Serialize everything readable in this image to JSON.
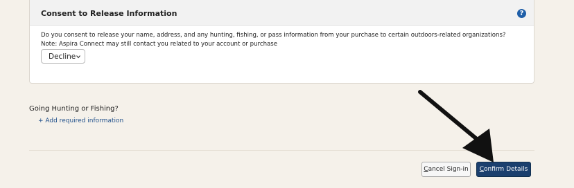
{
  "consent_panel": {
    "title": "Consent to Release Information",
    "help_icon_glyph": "?",
    "question": "Do you consent to release your name, address, and any hunting, fishing, or pass information from your purchase to certain outdoors-related organizations?",
    "note": "Note: Aspira Connect may still contact you related to your account or purchase",
    "select": {
      "selected": "Decline"
    }
  },
  "hunting_section": {
    "label": "Going Hunting or Fishing?",
    "add_link": "+ Add required information"
  },
  "footer": {
    "cancel_first_letter": "C",
    "cancel_rest": "ancel Sign-in",
    "confirm_first_letter": "C",
    "confirm_rest": "onfirm Details"
  },
  "colors": {
    "confirm_button": "#1b3f6e",
    "link": "#1f4f8a",
    "help_icon": "#1f5fa8",
    "background": "#f5f1ea"
  },
  "icons": {
    "help": "question-circle-icon",
    "select_chevron": "chevron-down-icon",
    "annotation": "arrow-icon"
  }
}
